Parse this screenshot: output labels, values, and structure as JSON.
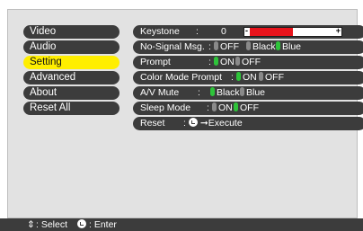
{
  "menu": {
    "items": [
      {
        "label": "Video"
      },
      {
        "label": "Audio"
      },
      {
        "label": "Setting",
        "selected": true
      },
      {
        "label": "Advanced"
      },
      {
        "label": "About"
      },
      {
        "label": "Reset All"
      }
    ]
  },
  "settings": {
    "keystone": {
      "label": "Keystone",
      "sep": ":",
      "value": "0",
      "minus": "-",
      "plus": "+",
      "level": 0.5
    },
    "no_signal": {
      "label": "No-Signal Msg.",
      "sep": ":",
      "options": [
        "OFF",
        "Black",
        "Blue"
      ],
      "selected": "Blue"
    },
    "prompt": {
      "label": "Prompt",
      "sep": ":",
      "options": [
        "ON",
        "OFF"
      ],
      "selected": "ON"
    },
    "color_mode_prompt": {
      "label": "Color Mode Prompt",
      "sep": ":",
      "options": [
        "ON",
        "OFF"
      ],
      "selected": "ON"
    },
    "av_mute": {
      "label": "A/V Mute",
      "sep": ":",
      "options": [
        "Black",
        "Blue"
      ],
      "selected": "Black"
    },
    "sleep_mode": {
      "label": "Sleep Mode",
      "sep": ":",
      "options": [
        "ON",
        "OFF"
      ],
      "selected": "OFF"
    },
    "reset": {
      "label": "Reset",
      "sep": ":",
      "action": "Execute",
      "icon": "enter-icon"
    }
  },
  "footer": {
    "select_label": ": Select",
    "enter_label": ": Enter",
    "select_icon": "up-down-arrows-icon",
    "enter_icon": "enter-icon"
  },
  "colors": {
    "panel_bg": "#e2e2e2",
    "item_bg": "#3c3c3c",
    "selected_bg": "#ffee00",
    "radio_on": "#2ec43a",
    "bar_fill": "#e8141c"
  }
}
